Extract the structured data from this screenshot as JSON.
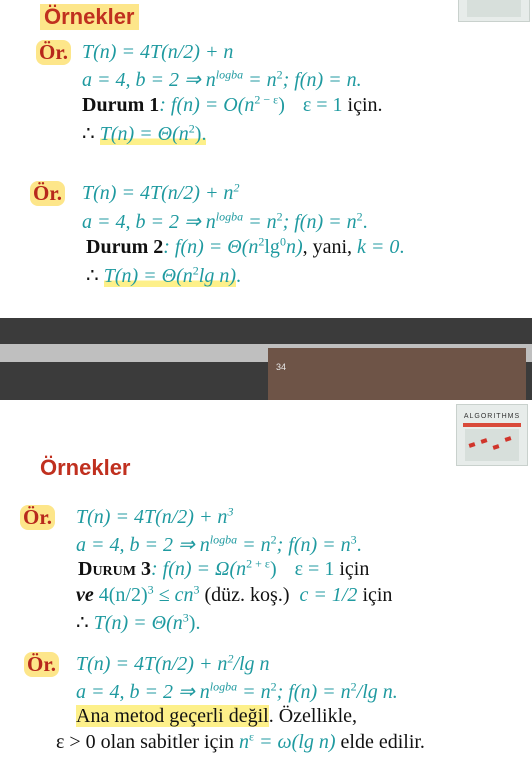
{
  "slide1": {
    "title": "Örnekler",
    "ex1": {
      "label": "Ör.",
      "l1": "T(n) = 4T(n/2) + n",
      "l2a": "a = 4, b = 2 ⇒ n",
      "l2sup": "logba",
      "l2b": " = n",
      "l2sup2": "2",
      "l2c": "; f(n) = n.",
      "l3case": "Durum 1",
      "l3a": ": f(n) = O(n",
      "l3sup": "2 − ε",
      "l3b": ")",
      "l3c": "ε = 1",
      "l3d": " için.",
      "l4a": "∴ ",
      "l4b": "T(n) = Θ(n",
      "l4sup": "2",
      "l4c": ")."
    },
    "ex2": {
      "label": "Ör.",
      "l1a": "T(n) = 4T(n/2) + n",
      "l1sup": "2",
      "l2a": "a = 4, b = 2 ⇒ n",
      "l2sup": "logba",
      "l2b": " = n",
      "l2sup2": "2",
      "l2c": "; f(n) = n",
      "l2sup3": "2",
      "l2d": ".",
      "l3case": "Durum 2",
      "l3a": ": f(n) = Θ(n",
      "l3sup": "2",
      "l3b": "lg",
      "l3sup2": "0",
      "l3c": "n)",
      "l3d": ", yani, ",
      "l3e": "k = 0",
      "l3f": ".",
      "l4a": "∴ ",
      "l4b": "T(n) = Θ(n",
      "l4sup": "2",
      "l4c": "lg n)",
      "l4d": "."
    }
  },
  "divider": {
    "page_number": "34"
  },
  "slide2": {
    "title": "Örnekler",
    "book_title": "ALGORITHMS",
    "ex3": {
      "label": "Ör.",
      "l1a": "T(n) = 4T(n/2) + n",
      "l1sup": "3",
      "l2a": "a = 4, b = 2 ⇒ n",
      "l2sup": "logba",
      "l2b": " = n",
      "l2sup2": "2",
      "l2c": "; f(n) = n",
      "l2sup3": "3",
      "l2d": ".",
      "l3case": "Durum 3",
      "l3a": ": f(n) = Ω(n",
      "l3sup": "2 + ε",
      "l3b": ")",
      "l3c": "ε = 1",
      "l3d": " için",
      "l4ve": "ve",
      "l4a": " 4(n/2)",
      "l4sup": "3",
      "l4b": " ≤ cn",
      "l4sup2": "3",
      "l4c": " (düz. koş.)",
      "l4d": "c = 1/2",
      "l4e": " için",
      "l5a": "∴ ",
      "l5b": "T(n) = Θ(n",
      "l5sup": "3",
      "l5c": ")."
    },
    "ex4": {
      "label": "Ör.",
      "l1a": "T(n) = 4T(n/2) + n",
      "l1sup": "2",
      "l1b": "/lg n",
      "l2a": "a = 4, b = 2 ⇒ n",
      "l2sup": "logba",
      "l2b": " = n",
      "l2sup2": "2",
      "l2c": "; f(n) = n",
      "l2sup3": "2",
      "l2d": "/lg n.",
      "l3a": "Ana metod geçerli değil",
      "l3b": ".  Özellikle,",
      "l4a": "ε > 0 olan sabitler için ",
      "l4b": "n",
      "l4sup": "ε",
      "l4c": " = ω(lg n)",
      "l4d": " elde edilir."
    }
  }
}
